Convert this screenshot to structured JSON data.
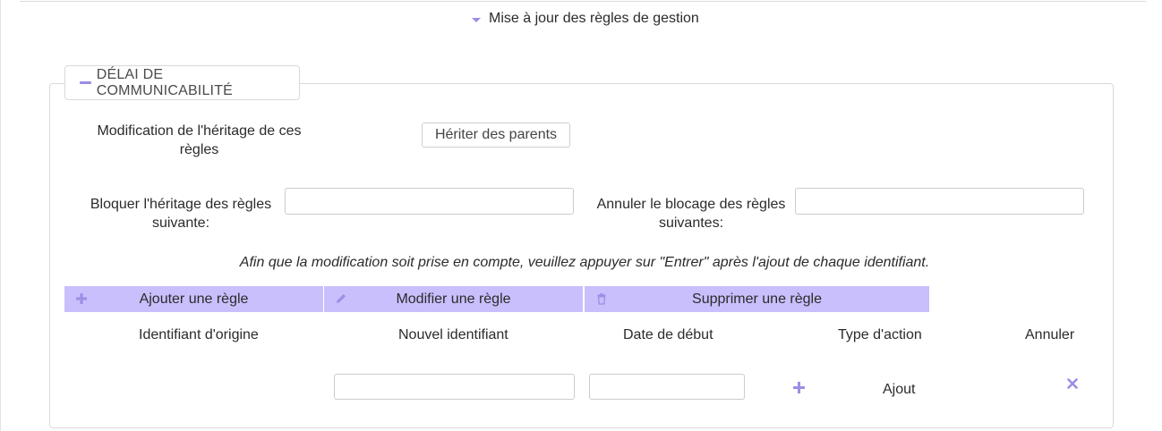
{
  "section": {
    "toggle_label": "Mise à jour des règles de gestion"
  },
  "panel": {
    "legend": "DÉLAI DE COMMUNICABILITÉ",
    "inheritance_label": "Modification de l'héritage de ces règles",
    "inherit_button": "Hériter des parents",
    "block_label": "Bloquer l'héritage des règles suivante:",
    "block_input_value": "",
    "unblock_label": "Annuler le blocage des règles suivantes:",
    "unblock_input_value": "",
    "hint": "Afin que la modification soit prise en compte, veuillez appuyer sur \"Entrer\" après l'ajout de chaque identifiant.",
    "actions": {
      "add": "Ajouter une règle",
      "edit": "Modifier une règle",
      "delete": "Supprimer une règle"
    },
    "table": {
      "headers": {
        "origin_id": "Identifiant d'origine",
        "new_id": "Nouvel identifiant",
        "start_date": "Date de début",
        "action_type": "Type d'action",
        "cancel": "Annuler"
      },
      "row": {
        "new_id_value": "",
        "start_date_value": "",
        "action_type": "Ajout"
      }
    }
  },
  "colors": {
    "accent": "#9b8ee6",
    "action_button_bg": "#c8bffc"
  },
  "icons": [
    "caret-down-icon",
    "minus-icon",
    "plus-icon",
    "pencil-icon",
    "trash-icon",
    "close-icon"
  ]
}
